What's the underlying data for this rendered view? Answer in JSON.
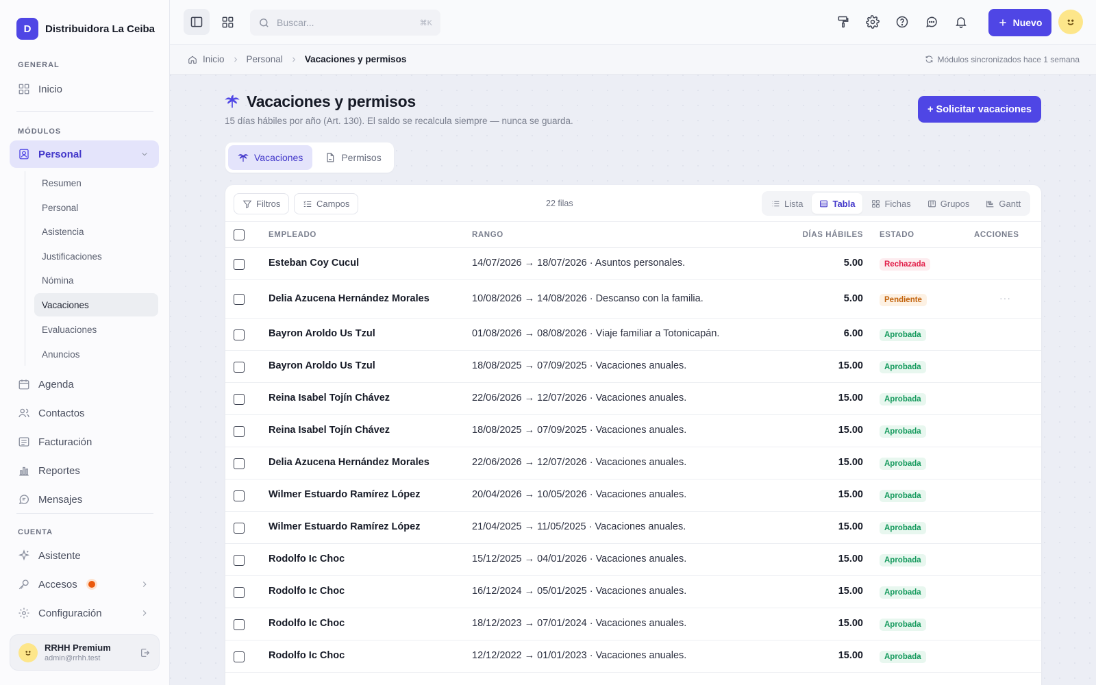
{
  "brand": {
    "initial": "D",
    "name": "Distribuidora La Ceiba"
  },
  "sidebar": {
    "general_label": "GENERAL",
    "inicio": "Inicio",
    "modulos_label": "MÓDULOS",
    "personal": "Personal",
    "sub_items": [
      "Resumen",
      "Personal",
      "Asistencia",
      "Justificaciones",
      "Nómina",
      "Vacaciones",
      "Evaluaciones",
      "Anuncios"
    ],
    "active_sub": "Vacaciones",
    "modules": [
      "Agenda",
      "Contactos",
      "Facturación",
      "Reportes",
      "Mensajes"
    ],
    "cuenta_label": "CUENTA",
    "asistente": "Asistente",
    "accesos": "Accesos",
    "configuracion": "Configuración",
    "user": {
      "name": "RRHH Premium",
      "email": "admin@rrhh.test"
    }
  },
  "topbar": {
    "search_placeholder": "Buscar...",
    "search_shortcut": "⌘K",
    "new_label": "Nuevo"
  },
  "breadcrumb": {
    "items": [
      "Inicio",
      "Personal",
      "Vacaciones y permisos"
    ],
    "sync": "Módulos sincronizados hace 1 semana"
  },
  "page": {
    "title": "Vacaciones y permisos",
    "subtitle": "15 días hábiles por año (Art. 130). El saldo se recalcula siempre — nunca se guarda.",
    "request_button": "+ Solicitar vacaciones",
    "tabs": [
      "Vacaciones",
      "Permisos"
    ]
  },
  "toolbar": {
    "filters": "Filtros",
    "fields": "Campos",
    "row_count": "22 filas",
    "views": [
      "Lista",
      "Tabla",
      "Fichas",
      "Grupos",
      "Gantt"
    ],
    "active_view": "Tabla"
  },
  "table": {
    "headers": {
      "employee": "EMPLEADO",
      "range": "RANGO",
      "days": "DÍAS HÁBILES",
      "status": "ESTADO",
      "actions": "ACCIONES"
    },
    "rows": [
      {
        "employee": "Esteban Coy Cucul",
        "range": "14/07/2026 → 18/07/2026 · Asuntos personales.",
        "days": "5.00",
        "status": "Rechazada"
      },
      {
        "employee": "Delia Azucena Hernández Morales",
        "range": "10/08/2026 → 14/08/2026 · Descanso con la familia.",
        "days": "5.00",
        "status": "Pendiente",
        "more": "···"
      },
      {
        "employee": "Bayron Aroldo Us Tzul",
        "range": "01/08/2026 → 08/08/2026 · Viaje familiar a Totonicapán.",
        "days": "6.00",
        "status": "Aprobada"
      },
      {
        "employee": "Bayron Aroldo Us Tzul",
        "range": "18/08/2025 → 07/09/2025 · Vacaciones anuales.",
        "days": "15.00",
        "status": "Aprobada"
      },
      {
        "employee": "Reina Isabel Tojín Chávez",
        "range": "22/06/2026 → 12/07/2026 · Vacaciones anuales.",
        "days": "15.00",
        "status": "Aprobada"
      },
      {
        "employee": "Reina Isabel Tojín Chávez",
        "range": "18/08/2025 → 07/09/2025 · Vacaciones anuales.",
        "days": "15.00",
        "status": "Aprobada"
      },
      {
        "employee": "Delia Azucena Hernández Morales",
        "range": "22/06/2026 → 12/07/2026 · Vacaciones anuales.",
        "days": "15.00",
        "status": "Aprobada"
      },
      {
        "employee": "Wilmer Estuardo Ramírez López",
        "range": "20/04/2026 → 10/05/2026 · Vacaciones anuales.",
        "days": "15.00",
        "status": "Aprobada"
      },
      {
        "employee": "Wilmer Estuardo Ramírez López",
        "range": "21/04/2025 → 11/05/2025 · Vacaciones anuales.",
        "days": "15.00",
        "status": "Aprobada"
      },
      {
        "employee": "Rodolfo Ic Choc",
        "range": "15/12/2025 → 04/01/2026 · Vacaciones anuales.",
        "days": "15.00",
        "status": "Aprobada"
      },
      {
        "employee": "Rodolfo Ic Choc",
        "range": "16/12/2024 → 05/01/2025 · Vacaciones anuales.",
        "days": "15.00",
        "status": "Aprobada"
      },
      {
        "employee": "Rodolfo Ic Choc",
        "range": "18/12/2023 → 07/01/2024 · Vacaciones anuales.",
        "days": "15.00",
        "status": "Aprobada"
      },
      {
        "employee": "Rodolfo Ic Choc",
        "range": "12/12/2022 → 01/01/2023 · Vacaciones anuales.",
        "days": "15.00",
        "status": "Aprobada"
      }
    ]
  },
  "colors": {
    "accent": "#4f46e5",
    "rejected": "#e11d48",
    "pending": "#c2620a",
    "approved": "#159a5d"
  }
}
